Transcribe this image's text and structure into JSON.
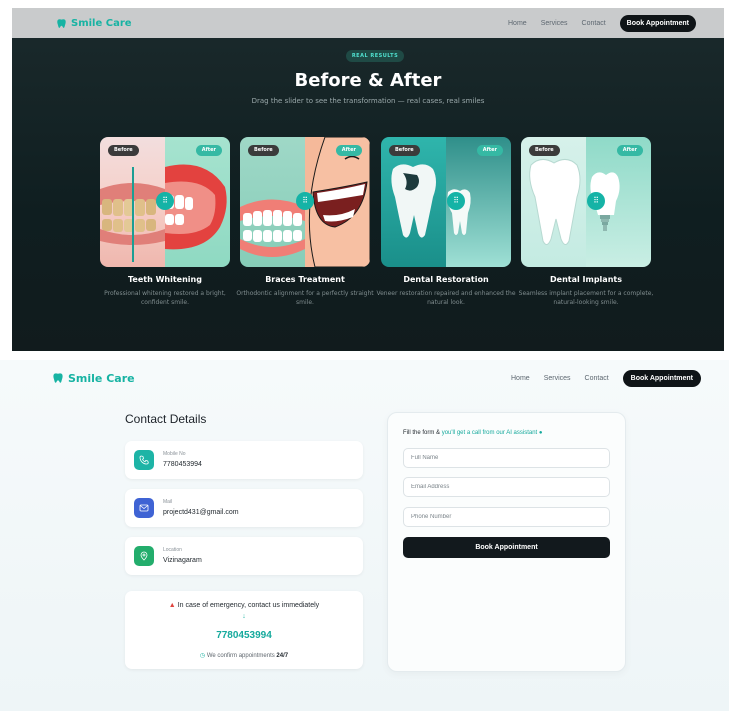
{
  "nav": {
    "logo_text": "Smile Care",
    "links": [
      "Home",
      "Services",
      "Contact"
    ],
    "cta_label": "Book Appointment"
  },
  "results": {
    "badge": "REAL RESULTS",
    "title": "Before & After",
    "subtitle": "Drag the slider to see the transformation — real cases, real smiles",
    "before_label": "Before",
    "after_label": "After",
    "cards": [
      {
        "title": "Teeth Whitening",
        "description": "Professional whitening restored a bright, confident smile."
      },
      {
        "title": "Braces Treatment",
        "description": "Orthodontic alignment for a perfectly straight smile."
      },
      {
        "title": "Dental Restoration",
        "description": "Veneer restoration repaired and enhanced the natural look."
      },
      {
        "title": "Dental Implants",
        "description": "Seamless implant placement for a complete, natural-looking smile."
      }
    ]
  },
  "contact": {
    "heading": "Contact Details",
    "items": [
      {
        "label": "Mobile No",
        "value": "7780453994",
        "icon": "phone-icon",
        "color": "#1db4a6"
      },
      {
        "label": "Mail",
        "value": "projectd431@gmail.com",
        "icon": "mail-icon",
        "color": "#3f63d4"
      },
      {
        "label": "Location",
        "value": "Vizinagaram",
        "icon": "location-icon",
        "color": "#23ad6c"
      }
    ],
    "emergency": {
      "text": "In case of emergency, contact us immediately",
      "arrow": "↓",
      "phone": "7780453994",
      "confirm_text": "We confirm appointments",
      "confirm_strong": "24/7"
    }
  },
  "form": {
    "title_prefix": "Fill the form & ",
    "title_highlight": "you'll get a call from our AI assistant",
    "fields": {
      "name_placeholder": "Full Name",
      "email_placeholder": "Email Address",
      "phone_placeholder": "Phone Number"
    },
    "submit_label": "Book Appointment"
  },
  "colors": {
    "brand": "#17b3a3",
    "dark": "#0f1417"
  }
}
